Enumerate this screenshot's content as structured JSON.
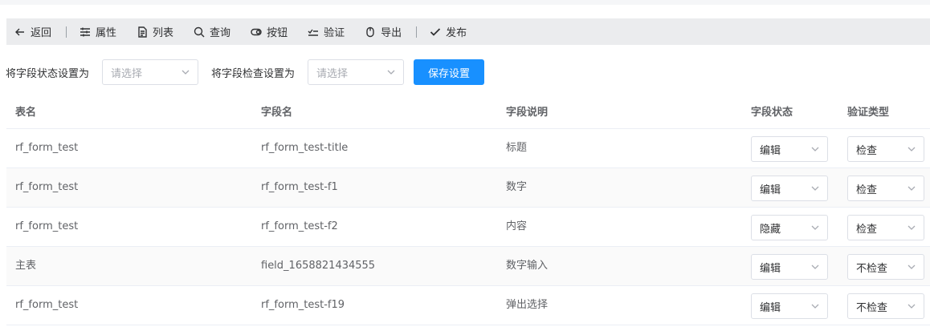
{
  "toolbar": {
    "back": "返回",
    "properties": "属性",
    "list": "列表",
    "query": "查询",
    "buttons": "按钮",
    "validate": "验证",
    "export": "导出",
    "publish": "发布"
  },
  "settings": {
    "status_label": "将字段状态设置为",
    "status_placeholder": "请选择",
    "check_label": "将字段检查设置为",
    "check_placeholder": "请选择",
    "save_label": "保存设置"
  },
  "table": {
    "headers": [
      "表名",
      "字段名",
      "字段说明",
      "字段状态",
      "验证类型"
    ],
    "rows": [
      {
        "table": "rf_form_test",
        "field": "rf_form_test-title",
        "desc": "标题",
        "status": "编辑",
        "check": "检查"
      },
      {
        "table": "rf_form_test",
        "field": "rf_form_test-f1",
        "desc": "数字",
        "status": "编辑",
        "check": "检查"
      },
      {
        "table": "rf_form_test",
        "field": "rf_form_test-f2",
        "desc": "内容",
        "status": "隐藏",
        "check": "检查"
      },
      {
        "table": "主表",
        "field": "field_1658821434555",
        "desc": "数字输入",
        "status": "编辑",
        "check": "不检查"
      },
      {
        "table": "rf_form_test",
        "field": "rf_form_test-f19",
        "desc": "弹出选择",
        "status": "编辑",
        "check": "不检查"
      }
    ]
  }
}
